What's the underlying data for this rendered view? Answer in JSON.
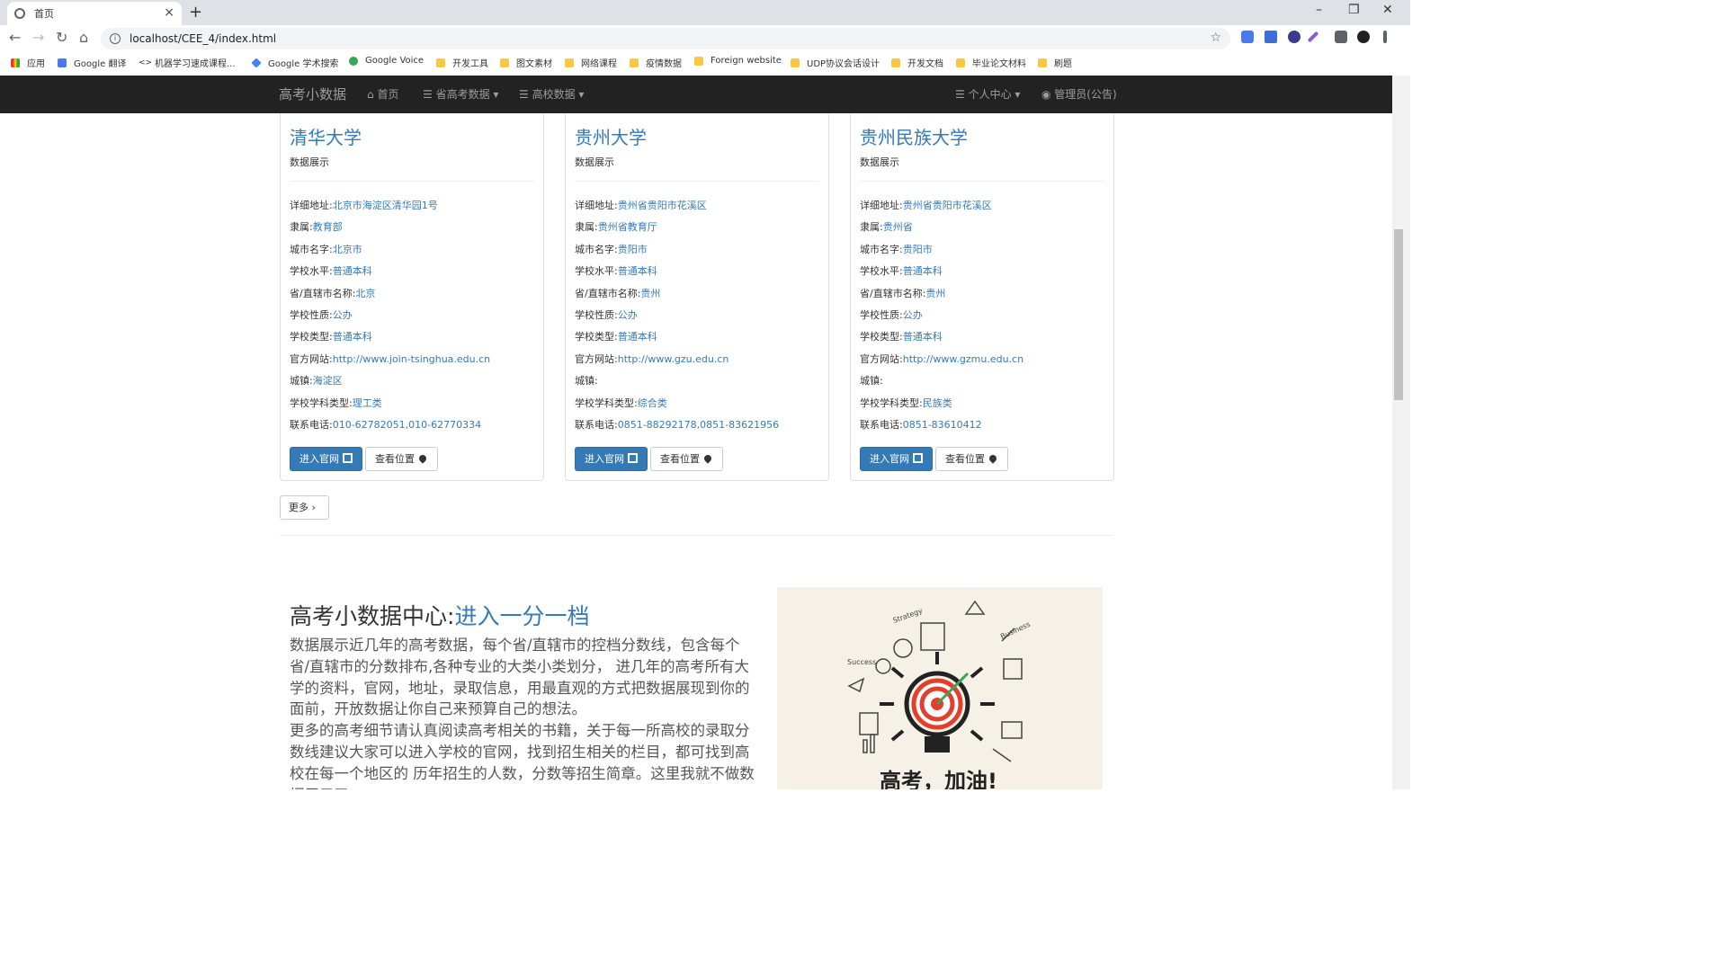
{
  "browser": {
    "tab_title": "首页",
    "url": "localhost/CEE_4/index.html",
    "bookmarks": [
      {
        "label": "应用",
        "icon": "apps-grid-icon"
      },
      {
        "label": "Google 翻译",
        "icon": "google-translate-icon"
      },
      {
        "label": "机器学习速成课程...",
        "icon": "code-brackets-icon"
      },
      {
        "label": "Google 学术搜索",
        "icon": "google-scholar-icon"
      },
      {
        "label": "Google Voice",
        "icon": "google-voice-icon"
      },
      {
        "label": "开发工具",
        "icon": "folder-icon"
      },
      {
        "label": "图文素材",
        "icon": "folder-icon"
      },
      {
        "label": "网络课程",
        "icon": "folder-icon"
      },
      {
        "label": "疫情数据",
        "icon": "folder-icon"
      },
      {
        "label": "Foreign website",
        "icon": "folder-icon"
      },
      {
        "label": "UDP协议会话设计",
        "icon": "folder-icon"
      },
      {
        "label": "开发文档",
        "icon": "folder-icon"
      },
      {
        "label": "毕业论文材料",
        "icon": "folder-icon"
      },
      {
        "label": "刷题",
        "icon": "folder-icon"
      }
    ]
  },
  "navbar": {
    "brand": "高考小数据",
    "home": "首页",
    "province_data": "省高考数据",
    "school_data": "高校数据",
    "personal_center": "个人中心",
    "admin": "管理员(公告)"
  },
  "cards": [
    {
      "name": "清华大学",
      "subtitle": "数据展示",
      "fields": [
        {
          "label": "详细地址:",
          "value": "北京市海淀区清华园1号"
        },
        {
          "label": "隶属:",
          "value": "教育部"
        },
        {
          "label": "城市名字:",
          "value": "北京市"
        },
        {
          "label": "学校水平:",
          "value": "普通本科"
        },
        {
          "label": "省/直辖市名称:",
          "value": "北京"
        },
        {
          "label": "学校性质:",
          "value": "公办"
        },
        {
          "label": "学校类型:",
          "value": "普通本科"
        },
        {
          "label": "官方网站:",
          "value": "http://www.join-tsinghua.edu.cn"
        },
        {
          "label": "城镇:",
          "value": "海淀区"
        },
        {
          "label": "学校学科类型:",
          "value": "理工类"
        },
        {
          "label": "联系电话:",
          "value": "010-62782051,010-62770334"
        }
      ],
      "btn_site": "进入官网",
      "btn_location": "查看位置"
    },
    {
      "name": "贵州大学",
      "subtitle": "数据展示",
      "fields": [
        {
          "label": "详细地址:",
          "value": "贵州省贵阳市花溪区"
        },
        {
          "label": "隶属:",
          "value": "贵州省教育厅"
        },
        {
          "label": "城市名字:",
          "value": "贵阳市"
        },
        {
          "label": "学校水平:",
          "value": "普通本科"
        },
        {
          "label": "省/直辖市名称:",
          "value": "贵州"
        },
        {
          "label": "学校性质:",
          "value": "公办"
        },
        {
          "label": "学校类型:",
          "value": "普通本科"
        },
        {
          "label": "官方网站:",
          "value": "http://www.gzu.edu.cn"
        },
        {
          "label": "城镇:",
          "value": ""
        },
        {
          "label": "学校学科类型:",
          "value": "综合类"
        },
        {
          "label": "联系电话:",
          "value": "0851-88292178,0851-83621956"
        }
      ],
      "btn_site": "进入官网",
      "btn_location": "查看位置"
    },
    {
      "name": "贵州民族大学",
      "subtitle": "数据展示",
      "fields": [
        {
          "label": "详细地址:",
          "value": "贵州省贵阳市花溪区"
        },
        {
          "label": "隶属:",
          "value": "贵州省"
        },
        {
          "label": "城市名字:",
          "value": "贵阳市"
        },
        {
          "label": "学校水平:",
          "value": "普通本科"
        },
        {
          "label": "省/直辖市名称:",
          "value": "贵州"
        },
        {
          "label": "学校性质:",
          "value": "公办"
        },
        {
          "label": "学校类型:",
          "value": "普通本科"
        },
        {
          "label": "官方网站:",
          "value": "http://www.gzmu.edu.cn"
        },
        {
          "label": "城镇:",
          "value": ""
        },
        {
          "label": "学校学科类型:",
          "value": "民族类"
        },
        {
          "label": "联系电话:",
          "value": "0851-83610412"
        }
      ],
      "btn_site": "进入官网",
      "btn_location": "查看位置"
    }
  ],
  "more_button": "更多",
  "feature": {
    "heading": "高考小数据中心:",
    "heading_link": "进入一分一档",
    "paragraph": "数据展示近几年的高考数据，每个省/直辖市的控档分数线，包含每个省/直辖市的分数排布,各种专业的大类小类划分， 进几年的高考所有大学的资料，官网，地址，录取信息，用最直观的方式把数据展现到你的面前，开放数据让你自己来预算自己的想法。",
    "paragraph2": "更多的高考细节请认真阅读高考相关的书籍，关于每一所高校的录取分数线建议大家可以进入学校的官网，找到招生相关的栏目，都可找到高校在每一个地区的 历年招生的人数，分数等招生简章。这里我就不做数据展示了。",
    "image_text": "高考，加油!",
    "image_words": [
      "Strategy",
      "Business",
      "Success"
    ]
  }
}
